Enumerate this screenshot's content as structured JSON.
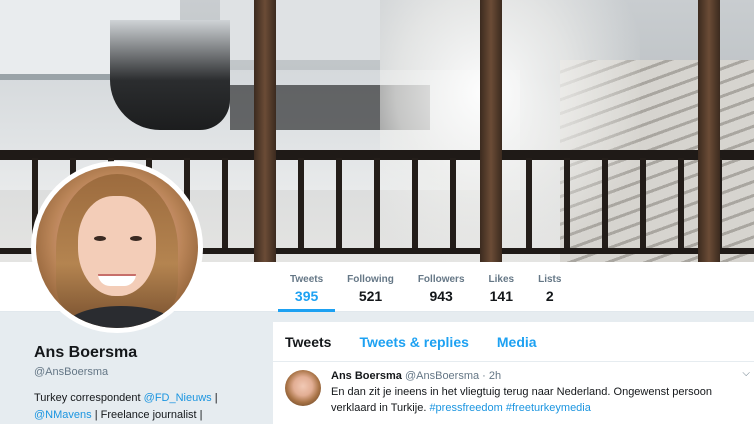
{
  "profile": {
    "name": "Ans Boersma",
    "handle": "@AnsBoersma",
    "bio_prefix": "Turkey correspondent ",
    "bio_mention1": "@FD_Nieuws",
    "bio_sep1": " |",
    "bio_mention2": "@NMavens",
    "bio_sep2": " | Freelance journalist |"
  },
  "stats": [
    {
      "label": "Tweets",
      "value": "395"
    },
    {
      "label": "Following",
      "value": "521"
    },
    {
      "label": "Followers",
      "value": "943"
    },
    {
      "label": "Likes",
      "value": "141"
    },
    {
      "label": "Lists",
      "value": "2"
    }
  ],
  "timeline": {
    "tabs": [
      "Tweets",
      "Tweets & replies",
      "Media"
    ],
    "tweet": {
      "name": "Ans Boersma",
      "handle": "@AnsBoersma",
      "sep": " · ",
      "time": "2h",
      "text": "En dan zit je ineens in het vliegtuig terug naar Nederland. Ongewenst persoon verklaard in Turkije.",
      "hashtag1": "#pressfreedom",
      "hashtag2": "#freeturkeymedia"
    }
  },
  "colors": {
    "accent": "#1da1f2",
    "link": "#1b95e0",
    "text": "#14171a",
    "muted": "#657786"
  },
  "icons": {
    "tweet_menu": "chevron-down-icon"
  }
}
